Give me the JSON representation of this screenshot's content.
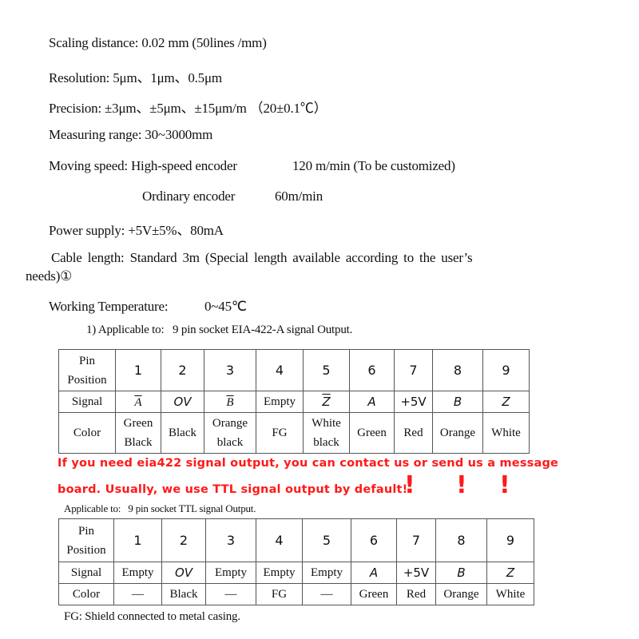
{
  "specs": {
    "scaling": "Scaling distance: 0.02 mm (50lines /mm)",
    "resolution": "Resolution: 5μm、1μm、0.5μm",
    "precision": "Precision: ±3μm、±5μm、±15μm/m （20±0.1℃）",
    "range": "Measuring range: 30~3000mm",
    "speed_label": "Moving speed: High-speed encoder",
    "speed_high": "120 m/min (To be customized)",
    "speed_ordinary_label": "Ordinary encoder",
    "speed_ordinary": "60m/min",
    "power": "Power supply: +5V±5%、80mA",
    "cable_line1": "Cable length: Standard 3m (Special length available according to the user’s",
    "cable_line2": "needs)①",
    "temperature_label": "Working Temperature:",
    "temperature_value": "0~45℃"
  },
  "table1": {
    "caption": "1) Applicable to:   9 pin socket EIA-422-A signal Output.",
    "header_label_line1": "Pin",
    "header_label_line2": "Position",
    "signal_label": "Signal",
    "color_label": "Color",
    "pins": [
      "1",
      "2",
      "3",
      "4",
      "5",
      "6",
      "7",
      "8",
      "9"
    ],
    "signals": [
      "A",
      "OV",
      "B",
      "Empty",
      "Z",
      "A",
      "+5V",
      "B",
      "Z"
    ],
    "colors_line1": [
      "Green",
      "Black",
      "Orange",
      "FG",
      "White",
      "Green",
      "Red",
      "Orange",
      "White"
    ],
    "colors_line2": [
      "Black",
      "",
      "black",
      "",
      "black",
      "",
      "",
      "",
      ""
    ]
  },
  "notice": {
    "line1": "If you need eia422 signal output, you can contact us or send us a message",
    "line2": "board. Usually, we use TTL signal output by default!",
    "marks": [
      "!",
      "!",
      "!"
    ],
    "color": "#ff1a1a"
  },
  "table2": {
    "caption": "Applicable to:   9 pin socket TTL signal Output.",
    "header_label_line1": "Pin",
    "header_label_line2": "Position",
    "signal_label": "Signal",
    "color_label": "Color",
    "pins": [
      "1",
      "2",
      "3",
      "4",
      "5",
      "6",
      "7",
      "8",
      "9"
    ],
    "signals": [
      "Empty",
      "OV",
      "Empty",
      "Empty",
      "Empty",
      "A",
      "+5V",
      "B",
      "Z"
    ],
    "colors": [
      "—",
      "Black",
      "—",
      "FG",
      "—",
      "Green",
      "Red",
      "Orange",
      "White"
    ]
  },
  "footnote": "FG: Shield connected to metal casing."
}
